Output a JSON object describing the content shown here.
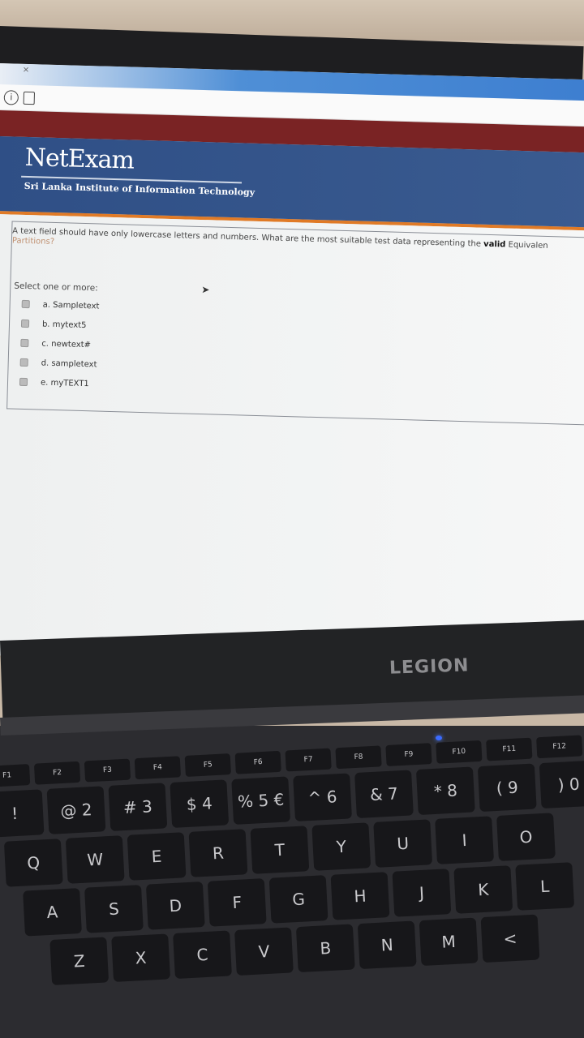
{
  "browser": {
    "tab_close": "×"
  },
  "site": {
    "title": "NetExam",
    "subtitle": "Sri Lanka Institute of Information Technology"
  },
  "question": {
    "text_before": "A text field should have only lowercase letters and numbers. What are the most suitable test data representing the ",
    "text_bold": "valid",
    "text_after": " Equivalen",
    "text_line2": "Partitions?",
    "prompt": "Select one or more:",
    "options": [
      {
        "label": "a. Sampletext",
        "checked": false
      },
      {
        "label": "b. mytext5",
        "checked": false
      },
      {
        "label": "c. newtext#",
        "checked": false
      },
      {
        "label": "d. sampletext",
        "checked": false
      },
      {
        "label": "e. myTEXT1",
        "checked": false
      }
    ]
  },
  "laptop": {
    "brand": "LEGION"
  },
  "keyboard": {
    "function_row": [
      "F1",
      "F2",
      "F3",
      "F4",
      "F5",
      "F6",
      "F7",
      "F8",
      "F9",
      "F10",
      "F11",
      "F12"
    ],
    "number_row": [
      "!",
      "@ 2",
      "# 3",
      "$ 4",
      "% 5 €",
      "^ 6",
      "& 7",
      "* 8",
      "( 9",
      ") 0"
    ],
    "top_row": [
      "Q",
      "W",
      "E",
      "R",
      "T",
      "Y",
      "U",
      "I",
      "O"
    ],
    "home_row": [
      "A",
      "S",
      "D",
      "F",
      "G",
      "H",
      "J",
      "K",
      "L"
    ],
    "bottom_row": [
      "Z",
      "X",
      "C",
      "V",
      "B",
      "N",
      "M",
      "<"
    ]
  }
}
